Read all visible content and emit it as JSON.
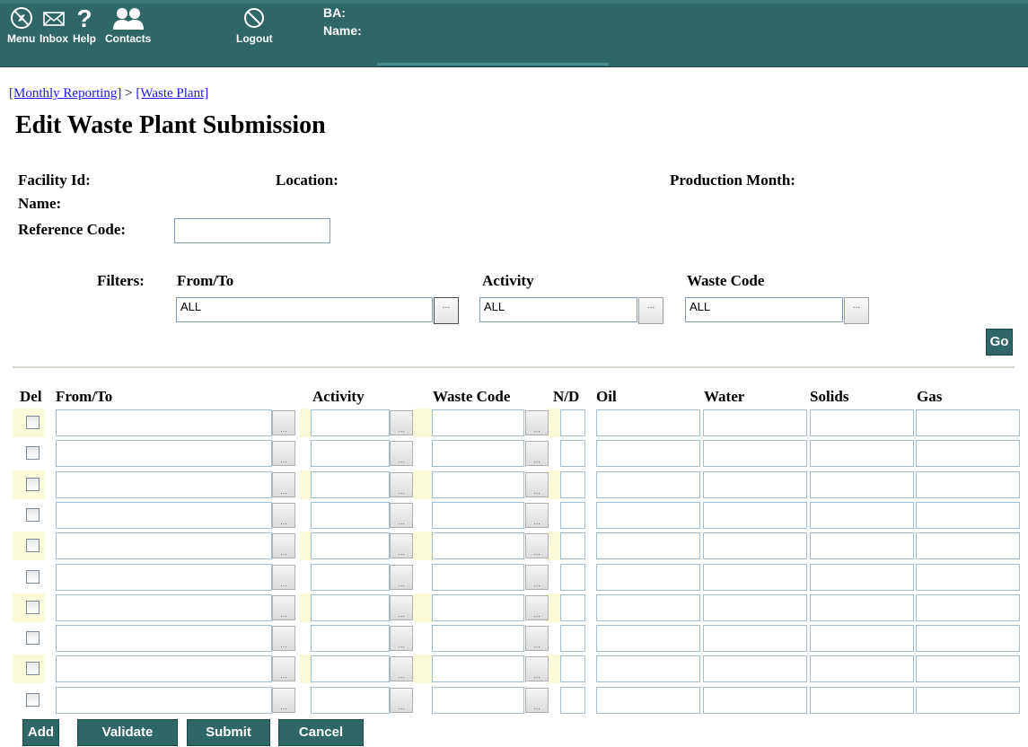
{
  "header": {
    "nav": [
      {
        "label": "Menu",
        "icon": "compass-icon"
      },
      {
        "label": "Inbox",
        "icon": "envelope-icon"
      },
      {
        "label": "Help",
        "icon": "question-icon"
      },
      {
        "label": "Contacts",
        "icon": "people-icon"
      },
      {
        "label": "Logout",
        "icon": "no-entry-icon"
      }
    ],
    "ba_label": "BA:",
    "name_label": "Name:",
    "bar_color": "#2f6666"
  },
  "breadcrumb": {
    "items": [
      "[Monthly Reporting]",
      "[Waste Plant]"
    ],
    "separator": ">"
  },
  "page_title": "Edit Waste Plant Submission",
  "facility": {
    "facility_id_label": "Facility Id:",
    "location_label": "Location:",
    "production_month_label": "Production Month:",
    "name_label": "Name:",
    "reference_code_label": "Reference Code:",
    "reference_code_value": ""
  },
  "filters": {
    "label": "Filters:",
    "from_to": {
      "label": "From/To",
      "value": "ALL"
    },
    "activity": {
      "label": "Activity",
      "value": "ALL"
    },
    "waste_code": {
      "label": "Waste Code",
      "value": "ALL"
    },
    "go_label": "Go"
  },
  "table": {
    "headers": {
      "del": "Del",
      "from_to": "From/To",
      "activity": "Activity",
      "waste_code": "Waste Code",
      "nd": "N/D",
      "oil": "Oil",
      "water": "Water",
      "solids": "Solids",
      "gas": "Gas"
    },
    "ellipsis": "...",
    "row_count": 10
  },
  "actions": {
    "add": "Add",
    "validate": "Validate",
    "submit": "Submit",
    "cancel": "Cancel"
  }
}
